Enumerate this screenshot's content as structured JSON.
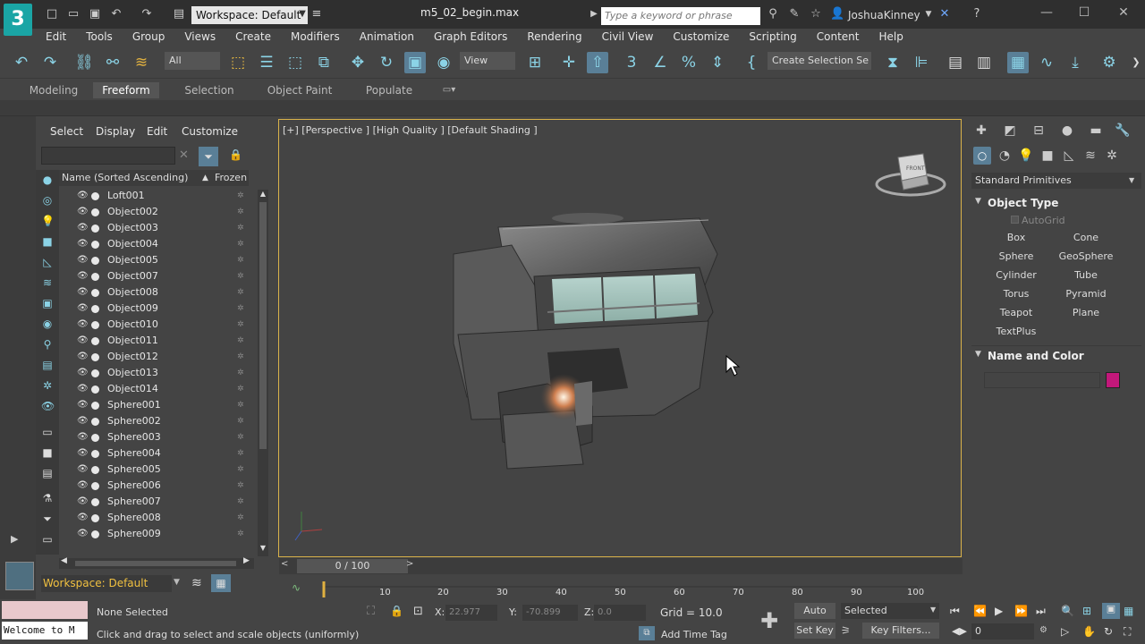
{
  "app": {
    "logo_text": "3",
    "workspace": "Workspace: Default",
    "document_title": "m5_02_begin.max",
    "search_placeholder": "Type a keyword or phrase",
    "user": "JoshuaKinney"
  },
  "menu": [
    "Edit",
    "Tools",
    "Group",
    "Views",
    "Create",
    "Modifiers",
    "Animation",
    "Graph Editors",
    "Rendering",
    "Civil View",
    "Customize",
    "Scripting",
    "Content",
    "Help"
  ],
  "toolbar": {
    "filter_value": "All",
    "ref_coord_value": "View",
    "selection_set_value": "Create Selection Se"
  },
  "ribbon_tabs": [
    "Modeling",
    "Freeform",
    "Selection",
    "Object Paint",
    "Populate"
  ],
  "ribbon_active": "Freeform",
  "scene_explorer": {
    "menu": [
      "Select",
      "Display",
      "Edit",
      "Customize"
    ],
    "column_name": "Name (Sorted Ascending)",
    "column_frozen": "Frozen",
    "sort_indicator": "▲",
    "items": [
      "Loft001",
      "Object002",
      "Object003",
      "Object004",
      "Object005",
      "Object007",
      "Object008",
      "Object009",
      "Object010",
      "Object011",
      "Object012",
      "Object013",
      "Object014",
      "Sphere001",
      "Sphere002",
      "Sphere003",
      "Sphere004",
      "Sphere005",
      "Sphere006",
      "Sphere007",
      "Sphere008",
      "Sphere009"
    ],
    "workspace_label": "Workspace: Default"
  },
  "viewport": {
    "label": "[+] [Perspective ] [High Quality ] [Default Shading ]",
    "viewcube_face": "FRONT"
  },
  "command_panel": {
    "category": "Standard Primitives",
    "object_type_title": "Object Type",
    "autogrid_label": "AutoGrid",
    "primitives": [
      "Box",
      "Cone",
      "Sphere",
      "GeoSphere",
      "Cylinder",
      "Tube",
      "Torus",
      "Pyramid",
      "Teapot",
      "Plane",
      "TextPlus"
    ],
    "name_color_title": "Name and Color",
    "object_color": "#c2187a"
  },
  "timeline": {
    "frame_readout": "0 / 100",
    "ticks": [
      "10",
      "20",
      "30",
      "40",
      "50",
      "60",
      "70",
      "80",
      "90",
      "100"
    ]
  },
  "status": {
    "maxscript_text": "Welcome to M",
    "selection_text": "None Selected",
    "prompt_text": "Click and drag to select and scale objects (uniformly)",
    "x_label": "X:",
    "x_value": "22.977",
    "y_label": "Y:",
    "y_value": "-70.899",
    "z_label": "Z:",
    "z_value": "0.0",
    "grid_text": "Grid = 10.0",
    "add_time_tag": "Add Time Tag",
    "auto_key": "Auto Key",
    "set_key": "Set Key",
    "key_mode_value": "Selected",
    "key_filters": "Key Filters...",
    "current_frame": "0"
  }
}
